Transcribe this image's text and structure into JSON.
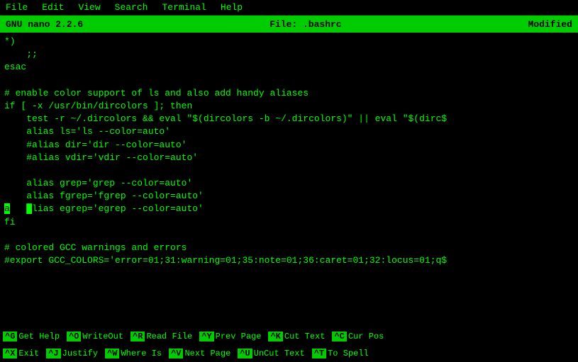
{
  "menubar": {
    "items": [
      "File",
      "Edit",
      "View",
      "Search",
      "Terminal",
      "Help"
    ]
  },
  "titlebar": {
    "left": "GNU nano 2.2.6",
    "center": "File: .bashrc",
    "right": "Modified"
  },
  "editor": {
    "lines": [
      "*)",
      "    ;;",
      "esac",
      "",
      "# enable color support of ls and also add handy aliases",
      "if [ -x /usr/bin/dircolors ]; then",
      "    test -r ~/.dircolors && eval \"$(dircolors -b ~/.dircolors)\" || eval \"$(dirc$",
      "    alias ls='ls --color=auto'",
      "    #alias dir='dir --color=auto'",
      "    #alias vdir='vdir --color=auto'",
      "",
      "    alias grep='grep --color=auto'",
      "    alias fgrep='fgrep --color=auto'",
      "    █lias egrep='egrep --color=auto'",
      "fi",
      "",
      "# colored GCC warnings and errors",
      "#export GCC_COLORS='error=01;31:warning=01;35:note=01;36:caret=01;32:locus=01;q$"
    ]
  },
  "shortcuts": {
    "row1": [
      {
        "key": "^G",
        "label": "Get Help"
      },
      {
        "key": "^O",
        "label": "WriteOut"
      },
      {
        "key": "^R",
        "label": "Read File"
      },
      {
        "key": "^Y",
        "label": "Prev Page"
      },
      {
        "key": "^K",
        "label": "Cut Text"
      },
      {
        "key": "^C",
        "label": "Cur Pos"
      }
    ],
    "row2": [
      {
        "key": "^X",
        "label": "Exit"
      },
      {
        "key": "^J",
        "label": "Justify"
      },
      {
        "key": "^W",
        "label": "Where Is"
      },
      {
        "key": "^V",
        "label": "Next Page"
      },
      {
        "key": "^U",
        "label": "UnCut Text"
      },
      {
        "key": "^T",
        "label": "To Spell"
      }
    ]
  }
}
